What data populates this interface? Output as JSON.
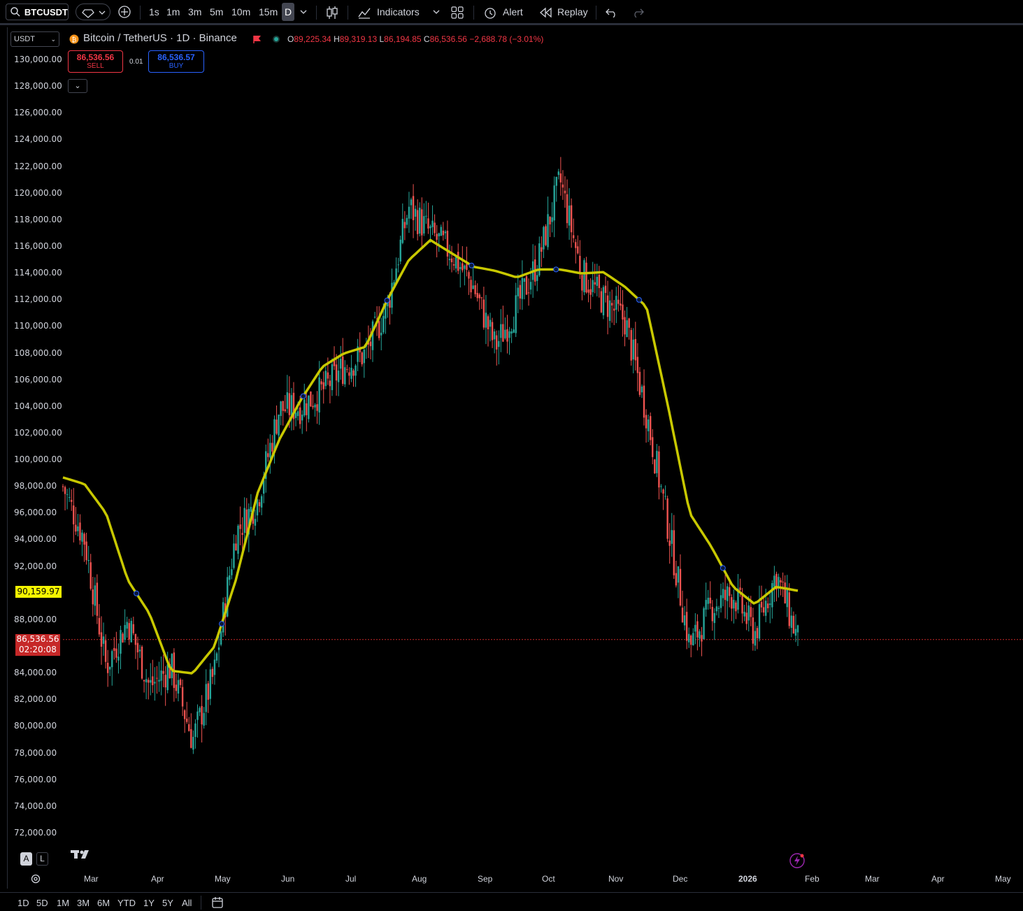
{
  "toolbar": {
    "symbol": "BTCUSDT",
    "timeframes": [
      "1s",
      "1m",
      "3m",
      "5m",
      "10m",
      "15m",
      "D"
    ],
    "active_timeframe": "D",
    "indicators_label": "Indicators",
    "alert_label": "Alert",
    "replay_label": "Replay"
  },
  "legend": {
    "title": "Bitcoin / TetherUS · 1D · Binance",
    "open_key": "O",
    "open": "89,225.34",
    "high_key": "H",
    "high": "89,319.13",
    "low_key": "L",
    "low": "86,194.85",
    "close_key": "C",
    "close": "86,536.56",
    "change": "−2,688.78 (−3.01%)"
  },
  "trade": {
    "sell_price": "86,536.56",
    "sell_label": "SELL",
    "buy_price": "86,536.57",
    "buy_label": "BUY",
    "spread": "0.01"
  },
  "currency": "USDT",
  "price_axis": [
    "130,000.00",
    "128,000.00",
    "126,000.00",
    "124,000.00",
    "122,000.00",
    "120,000.00",
    "118,000.00",
    "116,000.00",
    "114,000.00",
    "112,000.00",
    "110,000.00",
    "108,000.00",
    "106,000.00",
    "104,000.00",
    "102,000.00",
    "100,000.00",
    "98,000.00",
    "96,000.00",
    "94,000.00",
    "92,000.00",
    "88,000.00",
    "84,000.00",
    "82,000.00",
    "80,000.00",
    "78,000.00",
    "76,000.00",
    "74,000.00",
    "72,000.00"
  ],
  "badges": {
    "ma_value": "90,159.97",
    "last_price": "86,536.56",
    "countdown": "02:20:08"
  },
  "time_axis": [
    "Mar",
    "Apr",
    "May",
    "Jun",
    "Jul",
    "Aug",
    "Sep",
    "Oct",
    "Nov",
    "Dec",
    "2026",
    "Feb",
    "Mar",
    "Apr",
    "May"
  ],
  "scale_buttons": {
    "auto": "A",
    "log": "L"
  },
  "ranges": [
    "1D",
    "5D",
    "1M",
    "3M",
    "6M",
    "YTD",
    "1Y",
    "5Y",
    "All"
  ],
  "colors": {
    "up": "#26a69a",
    "down": "#ef5350",
    "ma": "#c8c800",
    "accent": "#2962ff"
  },
  "chart_data": {
    "type": "candlestick",
    "title": "Bitcoin / TetherUS · 1D · Binance",
    "ylim": [
      72000,
      130000
    ],
    "x": [
      "Feb",
      "Mar",
      "Mar",
      "Mar",
      "Mar",
      "Apr",
      "Apr",
      "Apr",
      "May",
      "May",
      "May",
      "Jun",
      "Jun",
      "Jun",
      "Jul",
      "Jul",
      "Jul",
      "Aug",
      "Aug",
      "Aug",
      "Sep",
      "Sep",
      "Sep",
      "Oct",
      "Oct",
      "Oct",
      "Nov",
      "Nov",
      "Nov",
      "Dec",
      "Dec",
      "Dec",
      "2026",
      "2026",
      "Jan"
    ],
    "close": [
      98000,
      94000,
      84500,
      88000,
      83000,
      84500,
      79000,
      84000,
      94500,
      97000,
      103800,
      104000,
      105200,
      107000,
      108000,
      111500,
      119000,
      117000,
      115500,
      113000,
      108500,
      111500,
      115000,
      121000,
      114000,
      112000,
      110500,
      103500,
      95000,
      86000,
      89000,
      90000,
      87000,
      91500,
      86500
    ],
    "ma": [
      98700,
      98200,
      96000,
      91000,
      88500,
      84200,
      84000,
      86000,
      91000,
      97500,
      101500,
      104500,
      107000,
      108000,
      108500,
      112000,
      115000,
      116500,
      115500,
      114500,
      114200,
      113700,
      114300,
      114300,
      114000,
      114100,
      113000,
      111500,
      104000,
      96000,
      93500,
      90500,
      89200,
      90500,
      90200
    ]
  }
}
